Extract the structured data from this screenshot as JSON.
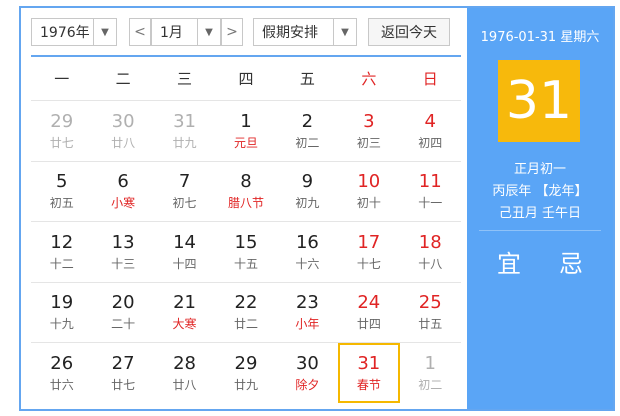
{
  "toolbar": {
    "year": "1976年",
    "prev": "<",
    "month": "1月",
    "next": ">",
    "holiday": "假期安排",
    "today": "返回今天"
  },
  "weekdays": [
    "一",
    "二",
    "三",
    "四",
    "五",
    "六",
    "日"
  ],
  "rows": [
    [
      {
        "d": "29",
        "l": "廿七",
        "cls": "other"
      },
      {
        "d": "30",
        "l": "廿八",
        "cls": "other"
      },
      {
        "d": "31",
        "l": "廿九",
        "cls": "other"
      },
      {
        "d": "1",
        "l": "元旦",
        "cls": "holiday"
      },
      {
        "d": "2",
        "l": "初二",
        "cls": ""
      },
      {
        "d": "3",
        "l": "初三",
        "cls": "weekend"
      },
      {
        "d": "4",
        "l": "初四",
        "cls": "weekend"
      }
    ],
    [
      {
        "d": "5",
        "l": "初五",
        "cls": ""
      },
      {
        "d": "6",
        "l": "小寒",
        "cls": "holiday"
      },
      {
        "d": "7",
        "l": "初七",
        "cls": ""
      },
      {
        "d": "8",
        "l": "腊八节",
        "cls": "holiday"
      },
      {
        "d": "9",
        "l": "初九",
        "cls": ""
      },
      {
        "d": "10",
        "l": "初十",
        "cls": "weekend"
      },
      {
        "d": "11",
        "l": "十一",
        "cls": "weekend"
      }
    ],
    [
      {
        "d": "12",
        "l": "十二",
        "cls": ""
      },
      {
        "d": "13",
        "l": "十三",
        "cls": ""
      },
      {
        "d": "14",
        "l": "十四",
        "cls": ""
      },
      {
        "d": "15",
        "l": "十五",
        "cls": ""
      },
      {
        "d": "16",
        "l": "十六",
        "cls": ""
      },
      {
        "d": "17",
        "l": "十七",
        "cls": "weekend"
      },
      {
        "d": "18",
        "l": "十八",
        "cls": "weekend"
      }
    ],
    [
      {
        "d": "19",
        "l": "十九",
        "cls": ""
      },
      {
        "d": "20",
        "l": "二十",
        "cls": ""
      },
      {
        "d": "21",
        "l": "大寒",
        "cls": "holiday"
      },
      {
        "d": "22",
        "l": "廿二",
        "cls": ""
      },
      {
        "d": "23",
        "l": "小年",
        "cls": "holiday"
      },
      {
        "d": "24",
        "l": "廿四",
        "cls": "weekend"
      },
      {
        "d": "25",
        "l": "廿五",
        "cls": "weekend"
      }
    ],
    [
      {
        "d": "26",
        "l": "廿六",
        "cls": ""
      },
      {
        "d": "27",
        "l": "廿七",
        "cls": ""
      },
      {
        "d": "28",
        "l": "廿八",
        "cls": ""
      },
      {
        "d": "29",
        "l": "廿九",
        "cls": ""
      },
      {
        "d": "30",
        "l": "除夕",
        "cls": "holiday"
      },
      {
        "d": "31",
        "l": "春节",
        "cls": "selected"
      },
      {
        "d": "1",
        "l": "初二",
        "cls": "other"
      }
    ]
  ],
  "side": {
    "date": "1976-01-31 星期六",
    "day": "31",
    "lunar": "正月初一",
    "ganzhi_year": "丙辰年 【龙年】",
    "ganzhi_day": "己丑月 壬午日",
    "yi": "宜",
    "ji": "忌"
  },
  "colors": {
    "accent": "#5aa5f6",
    "highlight": "#f7b90c",
    "red": "#e02424"
  }
}
